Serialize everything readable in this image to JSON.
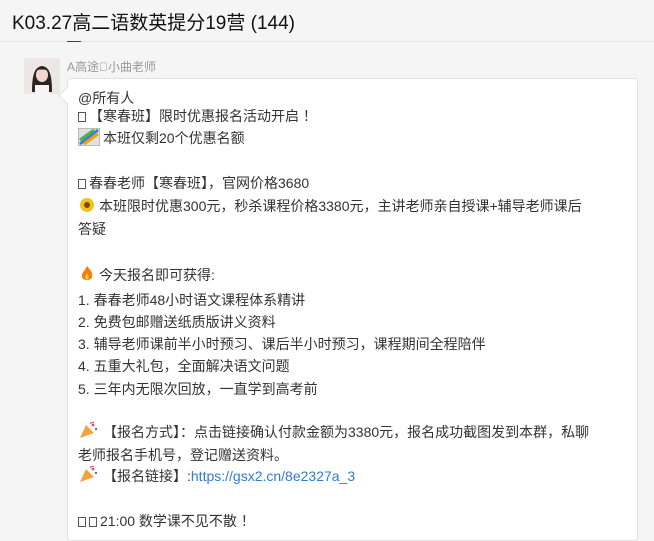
{
  "window": {
    "title": "K03.27高二语数英提分19营 (144)"
  },
  "sender": {
    "name": "A高途\u0000小曲老师"
  },
  "message": {
    "line1": "@所有人",
    "line2": "【寒春班】限时优惠报名活动开启 ！",
    "line3": "本班仅剩20个优惠名额",
    "line4": "春春老师【寒春班】，官网价格3680",
    "line5a": "本班限时优惠300元，秒杀课程价格3380元，主讲老师亲自授课+辅导老师课后",
    "line5b": "答疑",
    "line6": "今天报名即可获得:",
    "benefits": [
      "1. 春春老师48小时语文课程体系精讲",
      "2. 免费包邮赠送纸质版讲义资料",
      "3. 辅导老师课前半小时预习、课后半小时预习，课程期间全程陪伴",
      "4. 五重大礼包，全面解决语文问题",
      "5. 三年内无限次回放，一直学到高考前"
    ],
    "method_a": "【报名方式】：点击链接确认付款金额为3380元，报名成功截图发到本群，私聊",
    "method_b": "老师报名手机号，登记赠送资料。",
    "link_label": "【报名链接】:",
    "link_url": "https://gsx2.cn/8e2327a_3",
    "closing": "21:00 数学课不见不散 ！"
  },
  "icons": {
    "small_box": "box-icon",
    "stripes": "rainbow-stripes-icon",
    "sunflower": "sunflower-icon",
    "fire": "fire-icon",
    "party": "party-popper-icon"
  }
}
